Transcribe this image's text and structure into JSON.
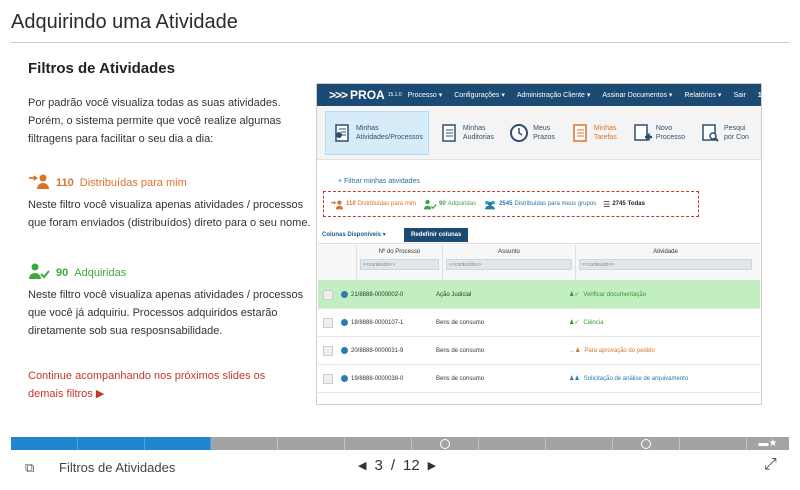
{
  "slide": {
    "title": "Adquirindo uma Atividade",
    "section": "Filtros de Atividades",
    "intro": "Por padrão você visualiza todas as suas atividades. Porém, o sistema permite que você realize algumas filtragens para facilitar o seu dia a dia:",
    "filter1": {
      "count": "110",
      "label": "Distribuídas para mim",
      "desc": "Neste filtro você visualiza apenas atividades / processos que foram enviados (distribuídos) direto para o seu nome."
    },
    "filter2": {
      "count": "90",
      "label": "Adquiridas",
      "desc": "Neste filtro você visualiza apenas atividades / processos que você já adquiriu. Processos adquiridos estarão diretamente sob sua resposnsabilidade."
    },
    "continue": "Continue acompanhando nos próximos slides os demais filtros ▶"
  },
  "shot": {
    "logo": "PROA",
    "version": "15.1.0",
    "nav": [
      "Processo ▾",
      "Configurações ▾",
      "Administração Cliente ▾",
      "Assinar Documentos ▾",
      "Relatórios ▾",
      "Sair",
      "1"
    ],
    "tiles": [
      {
        "l1": "Minhas",
        "l2": "Atividades/Processos"
      },
      {
        "l1": "Minhas",
        "l2": "Auditorias"
      },
      {
        "l1": "Meus",
        "l2": "Prazos"
      },
      {
        "l1": "Minhas",
        "l2": "Tarefas"
      },
      {
        "l1": "Novo",
        "l2": "Processo"
      },
      {
        "l1": "Pesqui",
        "l2": "por Con"
      }
    ],
    "filter_link": "+ Filtrar minhas atividades",
    "filters": [
      {
        "count": "110",
        "label": "Distribuídas para mim"
      },
      {
        "count": "90",
        "label": "Adquiridas"
      },
      {
        "count": "2545",
        "label": "Distribuídas para meus grupos"
      },
      {
        "count": "2745",
        "label": "Todas"
      }
    ],
    "cols_label": "Colunas Disponíveis",
    "reset_label": "Redefinir colunas",
    "headers": [
      "Nº do Processo",
      "Assunto",
      "Atividade"
    ],
    "placeholder": "<<conteúdo>>",
    "rows": [
      {
        "proc": "21/8888-0000002-0",
        "ass": "Ação Judicial",
        "atv": "Verificar documentação"
      },
      {
        "proc": "18/8888-0000107-1",
        "ass": "Bens de consumo",
        "atv": "Ciência"
      },
      {
        "proc": "20/8888-0000031-9",
        "ass": "Bens de consumo",
        "atv": "Para aprovação do pedido"
      },
      {
        "proc": "19/8888-0000038-0",
        "ass": "Bens de consumo",
        "atv": "Solicitação de análise de arquivamento"
      }
    ]
  },
  "player": {
    "slide_name": "Filtros de Atividades",
    "current": "3",
    "sep": "/",
    "total": "12"
  }
}
